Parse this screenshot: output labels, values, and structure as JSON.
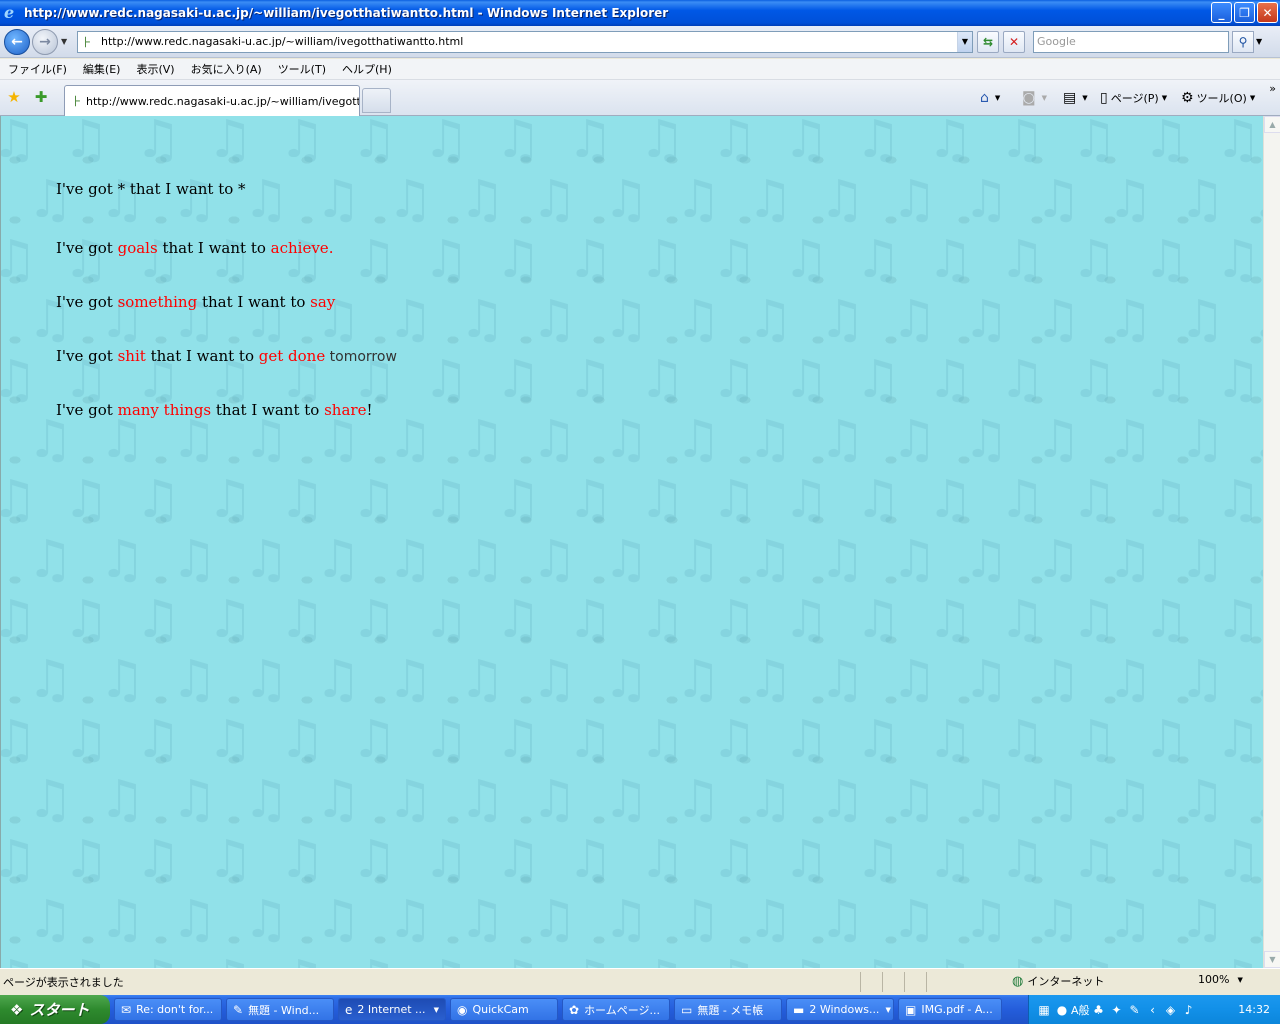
{
  "window": {
    "title": "http://www.redc.nagasaki-u.ac.jp/~william/ivegotthatiwantto.html - Windows Internet Explorer",
    "controls": [
      "_",
      "❐",
      "✕"
    ]
  },
  "address": {
    "url": "http://www.redc.nagasaki-u.ac.jp/~william/ivegotthatiwantto.html",
    "search_placeholder": "Google"
  },
  "menu": {
    "items": [
      "ファイル(F)",
      "編集(E)",
      "表示(V)",
      "お気に入り(A)",
      "ツール(T)",
      "ヘルプ(H)"
    ]
  },
  "tab": {
    "label": "http://www.redc.nagasaki-u.ac.jp/~william/ivegotth..."
  },
  "commandbar": {
    "page_label": "ページ(P)",
    "tools_label": "ツール(O)"
  },
  "content": {
    "lines": [
      {
        "parts": [
          "I've got * that I want to *"
        ]
      },
      {
        "a": "I've got ",
        "b": "goals",
        "c": " that I want to ",
        "d": "achieve",
        "e": "."
      },
      {
        "a": "I've got ",
        "b": "something",
        "c": " that I want to ",
        "d": "say",
        "e": ""
      },
      {
        "a": "I've got ",
        "b": "shit",
        "c": " that I want to ",
        "d": "get done",
        "e": " tomorrow"
      },
      {
        "a": "I've got ",
        "b": "many things",
        "c": " that I want to ",
        "d": "share",
        "e": "!"
      }
    ],
    "background_color": "#9ef4fb",
    "highlight_color": "#ff0000"
  },
  "status": {
    "text": "ページが表示されました",
    "zone": "インターネット",
    "zoom": "100%"
  },
  "taskbar": {
    "start_label": "スタート",
    "tasks": [
      {
        "label": "Re: don't for...",
        "icon": "mail-icon"
      },
      {
        "label": "無題 - Wind...",
        "icon": "paint-icon"
      },
      {
        "label": "2 Internet ...",
        "icon": "ie-icon"
      },
      {
        "label": "QuickCam",
        "icon": "webcam-icon"
      },
      {
        "label": "ホームページ...",
        "icon": "web-icon"
      },
      {
        "label": "無題 - メモ帳",
        "icon": "notepad-icon"
      },
      {
        "label": "2 Windows...",
        "icon": "folder-icon"
      },
      {
        "label": "IMG.pdf - A...",
        "icon": "pdf-icon"
      }
    ],
    "ime_label": "A般",
    "clock": "14:32"
  }
}
